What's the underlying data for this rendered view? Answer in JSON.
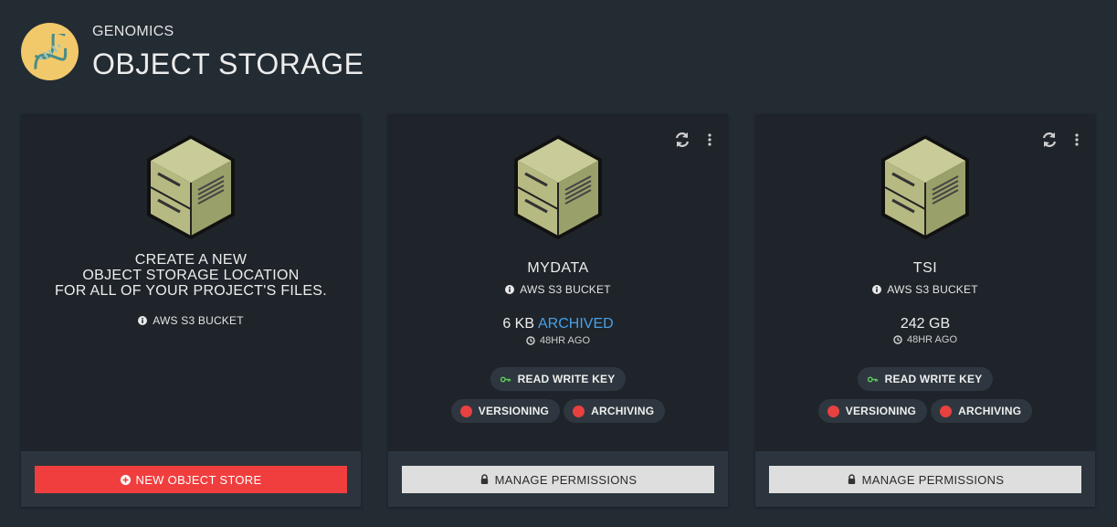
{
  "header": {
    "subtitle": "GENOMICS",
    "title": "OBJECT STORAGE",
    "logo_icon": "dna-icon",
    "logo_color": "#f2c96a"
  },
  "create_card": {
    "line1": "CREATE A NEW",
    "line2": "OBJECT STORAGE LOCATION",
    "line3": "FOR ALL OF YOUR PROJECT'S FILES.",
    "type_label": "AWS S3 BUCKET",
    "button_label": "NEW OBJECT STORE",
    "button_color": "#f03e3e"
  },
  "stores": [
    {
      "name": "MYDATA",
      "type_label": "AWS S3 BUCKET",
      "size": "6 KB",
      "status": "ARCHIVED",
      "updated": "48HR AGO",
      "key_label": "READ WRITE KEY",
      "versioning_label": "VERSIONING",
      "archiving_label": "ARCHIVING",
      "button_label": "MANAGE PERMISSIONS"
    },
    {
      "name": "TSI",
      "type_label": "AWS S3 BUCKET",
      "size": "242 GB",
      "status": "",
      "updated": "48HR AGO",
      "key_label": "READ WRITE KEY",
      "versioning_label": "VERSIONING",
      "archiving_label": "ARCHIVING",
      "button_label": "MANAGE PERMISSIONS"
    }
  ],
  "colors": {
    "background": "#232b33",
    "card": "#1e2429",
    "card_footer": "#2c353d",
    "accent_blue": "#4a9fe8",
    "status_red": "#e94040",
    "key_green": "#5cc85c"
  },
  "icons": {
    "storage": "filing-cabinet-icon",
    "refresh": "refresh-icon",
    "more": "more-vertical-icon",
    "info": "info-icon",
    "clock": "clock-icon",
    "key": "key-icon",
    "lock": "lock-icon",
    "plus": "plus-circle-icon"
  }
}
